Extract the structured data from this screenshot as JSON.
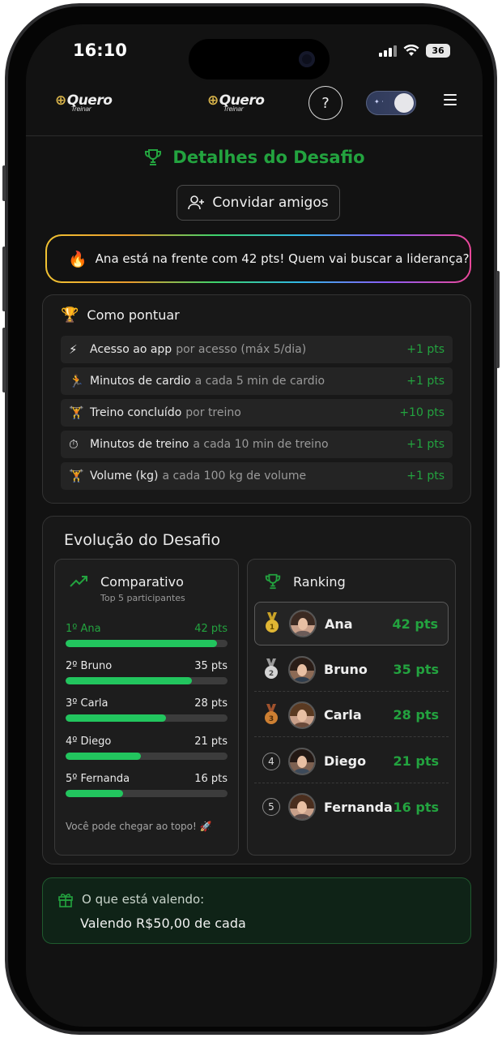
{
  "status_bar": {
    "time": "16:10",
    "battery": "36"
  },
  "header": {
    "logo_text": "Quero",
    "logo_sub": "Treinar",
    "help_icon": "question-circle-icon",
    "theme_toggle_icon": "moon-toggle-icon",
    "menu_icon": "hamburger-menu-icon"
  },
  "page": {
    "title": "Detalhes do Desafio",
    "invite_label": "Convidar amigos",
    "leader_banner": "Ana está na frente com 42 pts! Quem vai buscar a liderança?"
  },
  "scoring": {
    "title": "Como pontuar",
    "rules": [
      {
        "icon": "⚡",
        "name": "Acesso ao app",
        "desc": "por acesso (máx 5/dia)",
        "pts": "+1 pts"
      },
      {
        "icon": "🏃",
        "name": "Minutos de cardio",
        "desc": "a cada 5 min de cardio",
        "pts": "+1 pts"
      },
      {
        "icon": "🏋",
        "name": "Treino concluído",
        "desc": "por treino",
        "pts": "+10 pts"
      },
      {
        "icon": "⏱",
        "name": "Minutos de treino",
        "desc": "a cada 10 min de treino",
        "pts": "+1 pts"
      },
      {
        "icon": "🏋",
        "name": "Volume (kg)",
        "desc": "a cada 100 kg de volume",
        "pts": "+1 pts"
      }
    ]
  },
  "evolution": {
    "title": "Evolução do Desafio",
    "comparison": {
      "title": "Comparativo",
      "subtitle": "Top 5 participantes",
      "max": 45,
      "bars": [
        {
          "label": "1º Ana",
          "pts_text": "42 pts",
          "value": 42
        },
        {
          "label": "2º Bruno",
          "pts_text": "35 pts",
          "value": 35
        },
        {
          "label": "3º Carla",
          "pts_text": "28 pts",
          "value": 28
        },
        {
          "label": "4º Diego",
          "pts_text": "21 pts",
          "value": 21
        },
        {
          "label": "5º Fernanda",
          "pts_text": "16 pts",
          "value": 16
        }
      ],
      "footer": "Você pode chegar ao topo! 🚀"
    },
    "ranking": {
      "title": "Ranking",
      "rows": [
        {
          "pos": "1",
          "name": "Ana",
          "pts": "42 pts",
          "medal": "gold-medal-icon"
        },
        {
          "pos": "2",
          "name": "Bruno",
          "pts": "35 pts",
          "medal": "silver-medal-icon"
        },
        {
          "pos": "3",
          "name": "Carla",
          "pts": "28 pts",
          "medal": "bronze-medal-icon"
        },
        {
          "pos": "4",
          "name": "Diego",
          "pts": "21 pts",
          "medal": ""
        },
        {
          "pos": "5",
          "name": "Fernanda",
          "pts": "16 pts",
          "medal": ""
        }
      ]
    }
  },
  "prize": {
    "label": "O que está valendo:",
    "value": "Valendo R$50,00 de cada"
  },
  "colors": {
    "accent_green": "#23a33f",
    "bar_green": "#22c55e",
    "background": "#121212"
  }
}
